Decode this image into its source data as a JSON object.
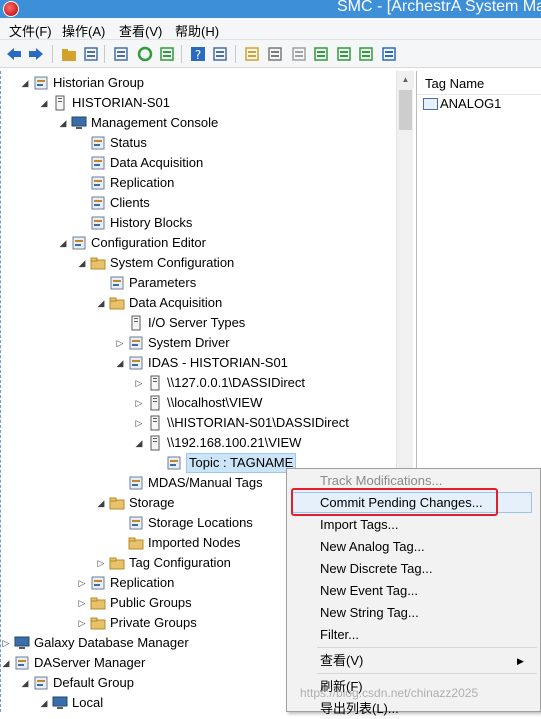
{
  "window": {
    "title": "SMC - [ArchestrA System Ma"
  },
  "menubar": [
    "文件(F)",
    "操作(A)",
    "查看(V)",
    "帮助(H)"
  ],
  "toolbar": {
    "buttons": [
      {
        "name": "back-icon",
        "color": "#2a6ac0"
      },
      {
        "name": "forward-icon",
        "color": "#2a6ac0"
      },
      {
        "name": "up-folder-icon",
        "color": "#d3a22a"
      },
      {
        "name": "show-hide-tree-icon",
        "color": "#4a6fa0"
      },
      {
        "name": "export-list-icon",
        "color": "#4a6fa0"
      },
      {
        "name": "refresh-icon",
        "color": "#2e9e3a"
      },
      {
        "name": "export-icon",
        "color": "#2e9e3a"
      },
      {
        "name": "help-icon",
        "color": "#2a6ac0"
      },
      {
        "name": "properties-icon",
        "color": "#4a6fa0"
      },
      {
        "name": "tag-import-icon",
        "color": "#d3a22a"
      },
      {
        "name": "tag-icon",
        "color": "#7a7a7a"
      },
      {
        "name": "tag-disabled-icon",
        "color": "#a0a0a0"
      },
      {
        "name": "new-tag-icon",
        "color": "#2e9e3a"
      },
      {
        "name": "add-tag-icon",
        "color": "#2e9e3a"
      },
      {
        "name": "wand-icon",
        "color": "#2e9e3a"
      },
      {
        "name": "sort-tag-icon",
        "color": "#2a6ac0"
      }
    ]
  },
  "tree": [
    {
      "label": "Historian Group",
      "icon": "server-group-icon",
      "toggle": "collapse"
    },
    {
      "label": "HISTORIAN-S01",
      "icon": "server-icon",
      "toggle": "collapse"
    },
    {
      "label": "Management Console",
      "icon": "console-icon",
      "toggle": "collapse"
    },
    {
      "label": "Status",
      "icon": "status-icon",
      "toggle": ""
    },
    {
      "label": "Data Acquisition",
      "icon": "data-acquisition-icon",
      "toggle": ""
    },
    {
      "label": "Replication",
      "icon": "replication-icon",
      "toggle": ""
    },
    {
      "label": "Clients",
      "icon": "clients-icon",
      "toggle": ""
    },
    {
      "label": "History Blocks",
      "icon": "history-blocks-icon",
      "toggle": ""
    },
    {
      "label": "Configuration Editor",
      "icon": "config-editor-icon",
      "toggle": "collapse"
    },
    {
      "label": "System Configuration",
      "icon": "folder-icon",
      "toggle": "collapse"
    },
    {
      "label": "Parameters",
      "icon": "parameters-icon",
      "toggle": ""
    },
    {
      "label": "Data Acquisition",
      "icon": "folder-icon",
      "toggle": "collapse"
    },
    {
      "label": "I/O Server Types",
      "icon": "io-server-icon",
      "toggle": ""
    },
    {
      "label": "System Driver",
      "icon": "driver-icon",
      "toggle": "expand"
    },
    {
      "label": "IDAS - HISTORIAN-S01",
      "icon": "idas-icon",
      "toggle": "collapse"
    },
    {
      "label": "\\\\127.0.0.1\\DASSIDirect",
      "icon": "io-server-icon",
      "toggle": "expand"
    },
    {
      "label": "\\\\localhost\\VIEW",
      "icon": "io-server-icon",
      "toggle": "expand"
    },
    {
      "label": "\\\\HISTORIAN-S01\\DASSIDirect",
      "icon": "io-server-icon",
      "toggle": "expand"
    },
    {
      "label": "\\\\192.168.100.21\\VIEW",
      "icon": "io-server-icon",
      "toggle": "collapse"
    },
    {
      "label": "Topic : TAGNAME",
      "icon": "topic-icon",
      "toggle": ""
    },
    {
      "label": "MDAS/Manual Tags",
      "icon": "manual-tags-icon",
      "toggle": ""
    },
    {
      "label": "Storage",
      "icon": "folder-icon",
      "toggle": "collapse"
    },
    {
      "label": "Storage Locations",
      "icon": "storage-locations-icon",
      "toggle": ""
    },
    {
      "label": "Imported Nodes",
      "icon": "folder-icon",
      "toggle": ""
    },
    {
      "label": "Tag Configuration",
      "icon": "folder-icon",
      "toggle": "expand"
    },
    {
      "label": "Replication",
      "icon": "replication-icon",
      "toggle": "expand"
    },
    {
      "label": "Public Groups",
      "icon": "folder-icon",
      "toggle": "expand"
    },
    {
      "label": "Private Groups",
      "icon": "folder-icon",
      "toggle": "expand"
    },
    {
      "label": "Galaxy Database Manager",
      "icon": "galaxy-db-icon",
      "toggle": "expand"
    },
    {
      "label": "DAServer Manager",
      "icon": "daserver-icon",
      "toggle": "collapse"
    },
    {
      "label": "Default Group",
      "icon": "group-icon",
      "toggle": "collapse"
    },
    {
      "label": "Local",
      "icon": "computer-icon",
      "toggle": "collapse"
    }
  ],
  "list": {
    "column": "Tag Name",
    "rows": [
      "ANALOG1"
    ]
  },
  "context_menu": {
    "items": [
      {
        "label": "Track Modifications...",
        "disabled": true
      },
      {
        "label": "Commit Pending Changes...",
        "disabled": false,
        "highlighted": true
      },
      {
        "label": "Import Tags...",
        "disabled": false
      },
      {
        "label": "New Analog Tag...",
        "disabled": false
      },
      {
        "label": "New Discrete Tag...",
        "disabled": false
      },
      {
        "label": "New Event Tag...",
        "disabled": false
      },
      {
        "label": "New String Tag...",
        "disabled": false
      },
      {
        "label": "Filter...",
        "disabled": false
      },
      {
        "label": "查看(V)",
        "disabled": false,
        "submenu": true
      },
      {
        "label": "刷新(F)",
        "disabled": false
      },
      {
        "label": "导出列表(L)...",
        "disabled": false
      }
    ]
  },
  "watermark": "https://blog.csdn.net/chinazz2025",
  "colors": {
    "titlebar": "#3d8fd8",
    "selection": "#cce4f7",
    "highlight_box": "#e0202a",
    "folder": "#e8c26a"
  }
}
